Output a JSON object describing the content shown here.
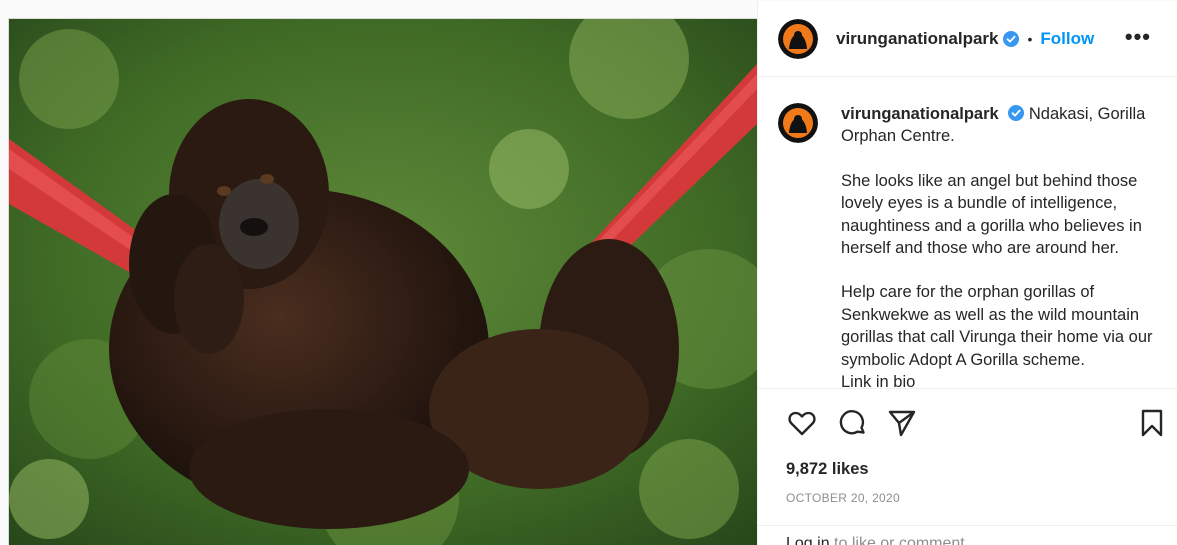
{
  "post": {
    "image_alt": "Young gorilla hanging on a red hammock strap",
    "account": {
      "username": "virunganationalpark",
      "verified_icon": "verified-badge-icon",
      "separator": "•",
      "follow_label": "Follow",
      "more_icon": "•••"
    },
    "caption": {
      "username": "virunganationalpark",
      "line1": "Ndakasi, Gorilla Orphan Centre.",
      "para2": "She looks like an angel but behind those lovely eyes is a bundle of intelligence, naughtiness and a gorilla who believes in herself and those who are around her.",
      "para3": "Help care for the orphan gorillas of Senkwekwe as well as the wild mountain gorillas that call Virunga their home via our symbolic Adopt A Gorilla scheme.",
      "para3_cut": "Link in bio"
    },
    "actions": {
      "like_icon": "heart-icon",
      "comment_icon": "comment-icon",
      "share_icon": "share-icon",
      "save_icon": "bookmark-icon"
    },
    "likes": "9,872 likes",
    "date": "OCTOBER 20, 2020",
    "login": {
      "link": "Log in",
      "rest": " to like or comment."
    }
  },
  "colors": {
    "accent": "#0095f6",
    "text": "#262626",
    "muted": "#8e8e8e",
    "border": "#efefef"
  }
}
